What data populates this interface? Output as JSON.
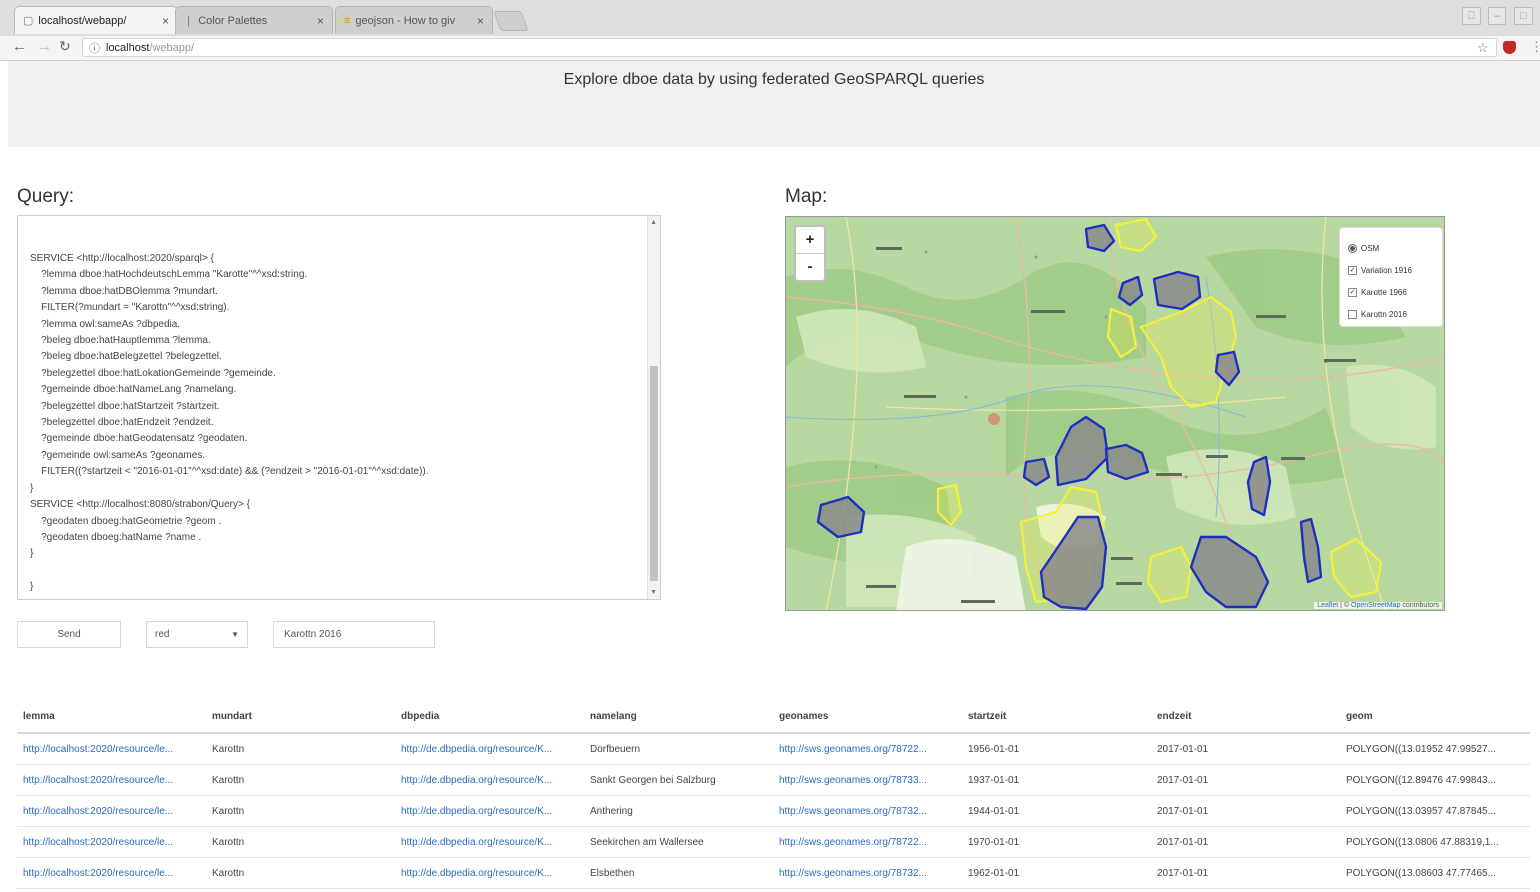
{
  "browser": {
    "tabs": [
      {
        "label": "localhost/webapp/",
        "icon": "page-icon"
      },
      {
        "label": "Color Palettes",
        "icon": "palette-icon"
      },
      {
        "label": "geojson - How to giv",
        "icon": "stackoverflow-icon"
      }
    ],
    "close_glyph": "×",
    "address": {
      "host": "localhost",
      "path": "/webapp/"
    }
  },
  "page": {
    "title": "Explore dboe data by using federated GeoSPARQL queries",
    "query_heading": "Query:",
    "map_heading": "Map:"
  },
  "query": {
    "text": "SERVICE <http://localhost:2020/sparql> {\n    ?lemma dboe:hatHochdeutschLemma \"Karotte\"^^xsd:string.\n    ?lemma dboe:hatDBOlemma ?mundart.\n    FILTER(?mundart = \"Karottn\"^^xsd:string).\n    ?lemma owl:sameAs ?dbpedia.\n    ?beleg dboe:hatHauptlemma ?lemma.\n    ?beleg dboe:hatBelegzettel ?belegzettel.\n    ?belegzettel dboe:hatLokationGemeinde ?gemeinde.\n    ?gemeinde dboe:hatNameLang ?namelang.\n    ?belegzettel dboe:hatStartzeit ?startzeit.\n    ?belegzettel dboe:hatEndzeit ?endzeit.\n    ?gemeinde dboe:hatGeodatensatz ?geodaten.\n    ?gemeinde owl:sameAs ?geonames.\n    FILTER((?startzeit < \"2016-01-01\"^^xsd:date) && (?endzeit > \"2016-01-01\"^^xsd:date)).\n}\nSERVICE <http://localhost:8080/strabon/Query> {\n    ?geodaten dboeg:hatGeometrie ?geom .\n    ?geodaten dboeg:hatName ?name .\n}\n\n}"
  },
  "controls": {
    "send_label": "Send",
    "color_select": "red",
    "layer_name": "Karottn 2016"
  },
  "map": {
    "zoom_in": "+",
    "zoom_out": "-",
    "base_layer": "OSM",
    "overlays": [
      {
        "label": "Variation 1916",
        "checked": true
      },
      {
        "label": "Karotte 1966",
        "checked": true
      },
      {
        "label": "Karottn 2016",
        "checked": false
      }
    ],
    "checkmark": "✓",
    "attribution_leaflet": "Leaflet",
    "attribution_sep": " | © ",
    "attribution_osm": "OpenStreetMap",
    "attribution_tail": " contributors",
    "colors": {
      "land": "#b7d8a0",
      "blue_outline": "#1f2fbf",
      "yellow": "#f5f03c",
      "grey_fill": "#8a8a8a"
    }
  },
  "table": {
    "columns": [
      "lemma",
      "mundart",
      "dbpedia",
      "namelang",
      "geonames",
      "startzeit",
      "endzeit",
      "geom"
    ],
    "rows": [
      [
        "http://localhost:2020/resource/le...",
        "Karottn",
        "http://de.dbpedia.org/resource/K...",
        "Dorfbeuern",
        "http://sws.geonames.org/78722...",
        "1956-01-01",
        "2017-01-01",
        "POLYGON((13.01952 47.99527..."
      ],
      [
        "http://localhost:2020/resource/le...",
        "Karottn",
        "http://de.dbpedia.org/resource/K...",
        "Sankt Georgen bei Salzburg",
        "http://sws.geonames.org/78733...",
        "1937-01-01",
        "2017-01-01",
        "POLYGON((12.89476 47.99843..."
      ],
      [
        "http://localhost:2020/resource/le...",
        "Karottn",
        "http://de.dbpedia.org/resource/K...",
        "Anthering",
        "http://sws.geonames.org/78732...",
        "1944-01-01",
        "2017-01-01",
        "POLYGON((13.03957 47.87845..."
      ],
      [
        "http://localhost:2020/resource/le...",
        "Karottn",
        "http://de.dbpedia.org/resource/K...",
        "Seekirchen am Wallersee",
        "http://sws.geonames.org/78722...",
        "1970-01-01",
        "2017-01-01",
        "POLYGON((13.0806 47.88319,1..."
      ],
      [
        "http://localhost:2020/resource/le...",
        "Karottn",
        "http://de.dbpedia.org/resource/K...",
        "Elsbethen",
        "http://sws.geonames.org/78732...",
        "1962-01-01",
        "2017-01-01",
        "POLYGON((13.08603 47.77465..."
      ]
    ]
  }
}
